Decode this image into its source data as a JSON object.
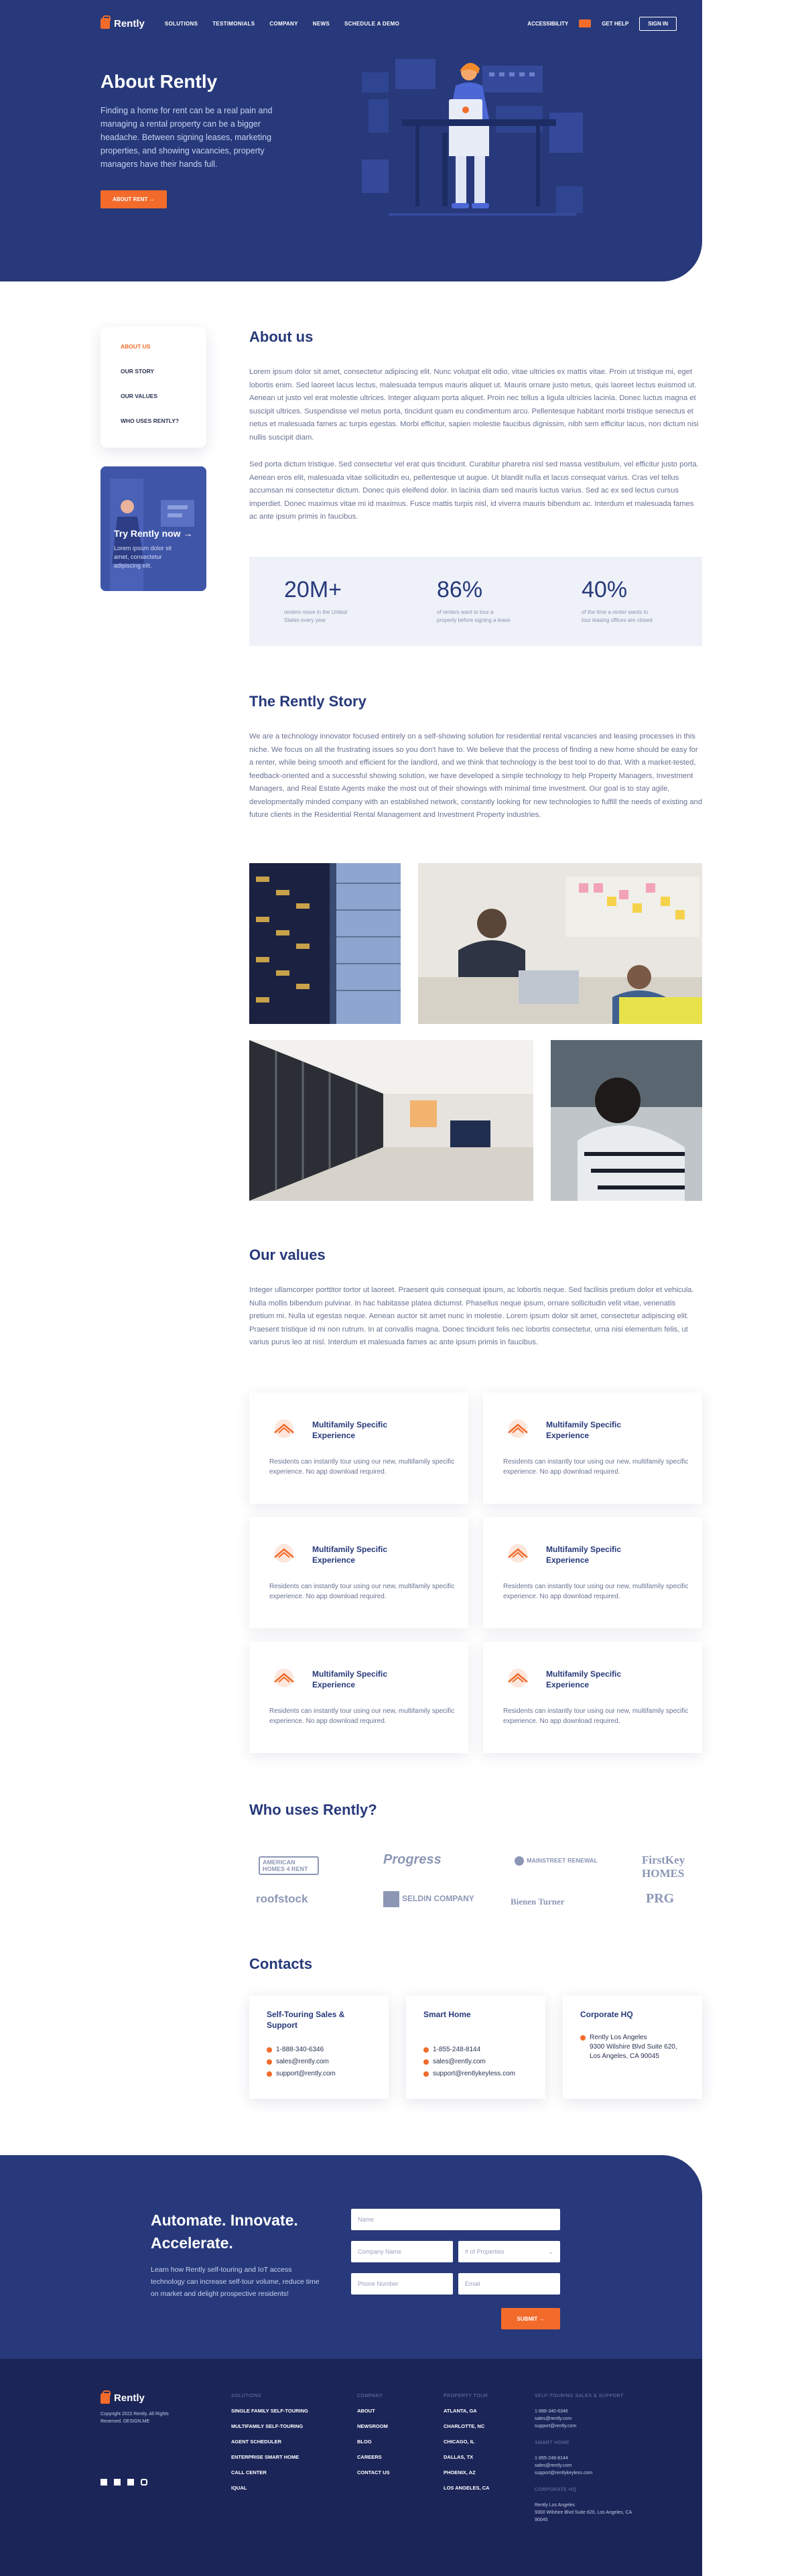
{
  "nav": {
    "brand": "Rently",
    "links": [
      "SOLUTIONS",
      "TESTIMONIALS",
      "COMPANY",
      "NEWS",
      "SCHEDULE A DEMO"
    ],
    "accessibility": "ACCESSIBILITY",
    "get_help": "GET HELP",
    "sign_in": "SIGN IN"
  },
  "hero": {
    "title": "About Rently",
    "text": "Finding a home for rent can be a real pain and managing a rental property can be a bigger headache. Between signing leases, marketing properties, and showing vacancies, property managers have their hands full.",
    "button": "ABOUT RENT"
  },
  "sidebar": {
    "items": [
      "ABOUT US",
      "OUR STORY",
      "OUR VALUES",
      "WHO USES RENTLY?"
    ],
    "try_title": "Try Rently now",
    "try_sub": "Lorem ipsum dolor sit amet, consectetur adipiscing elit."
  },
  "about": {
    "title": "About us",
    "p1": "Lorem ipsum dolor sit amet, consectetur adipiscing elit. Nunc volutpat elit odio, vitae ultricies ex mattis vitae. Proin ut tristique mi, eget lobortis enim. Sed laoreet lacus lectus, malesuada tempus mauris aliquet ut. Mauris ornare justo metus, quis laoreet lectus euismod ut. Aenean ut justo vel erat molestie ultrices. Integer aliquam porta aliquet. Proin nec tellus a ligula ultricies lacinia. Donec luctus magna et suscipit ultrices. Suspendisse vel metus porta, tincidunt quam eu condimentum arcu. Pellentesque habitant morbi tristique senectus et netus et malesuada fames ac turpis egestas. Morbi efficitur, sapien molestie faucibus dignissim, nibh sem efficitur lacus, non dictum nisi nullis suscipit diam.",
    "p2": "Sed porta dictum tristique. Sed consectetur vel erat quis tincidunt. Curabitur pharetra nisl sed massa vestibulum, vel efficitur justo porta. Aenean eros elit, malesuada vitae sollicitudin eu, pellentesque ut augue. Ut blandit nulla et lacus consequat varius. Cras vel tellus accumsan mi consectetur dictum. Donec quis eleifend dolor. In lacinia diam sed mauris luctus varius. Sed ac ex sed lectus cursus imperdiet. Donec maximus vitae mi id maximus. Fusce mattis turpis nisl, id viverra mauris bibendum ac. Interdum et malesuada fames ac ante ipsum primis in faucibus."
  },
  "stats": [
    {
      "value": "20M+",
      "desc": "renters move in the United States every year"
    },
    {
      "value": "86%",
      "desc": "of renters want to tour a property before signing a lease"
    },
    {
      "value": "40%",
      "desc": "of the time a renter wants to tour leasing offices are closed"
    }
  ],
  "story": {
    "title": "The Rently Story",
    "text": "We are a technology innovator focused entirely on a self-showing solution for residential rental vacancies and leasing processes in this niche. We focus on all the frustrating issues so you don't have to. We believe that the process of finding a new home should be easy for a renter, while being smooth and efficient for the landlord, and we think that technology is the best tool to do that. With a market-tested, feedback-oriented and a successful showing solution, we have developed a simple technology to help Property Managers, Investment Managers, and Real Estate Agents make the most out of their showings with minimal time investment. Our goal is to stay agile, developmentally minded company with an established network, constantly looking for new technologies to fulfill the needs of existing and future clients in the Residential Rental Management and Investment Property industries."
  },
  "values": {
    "title": "Our values",
    "text": "Integer ullamcorper porttitor tortor ut laoreet. Praesent quis consequat ipsum, ac lobortis neque. Sed facilisis pretium dolor et vehicula. Nulla mollis bibendum pulvinar. In hac habitasse platea dictumst. Phasellus neque ipsum, ornare sollicitudin velit vitae, venenatis pretium mi. Nulla ut egestas neque. Aenean auctor sit amet nunc in molestie. Lorem ipsum dolor sit amet, consectetur adipiscing elit. Praesent tristique id mi non rutrum. In at convallis magna. Donec tincidunt felis nec lobortis consectetur, urna nisi elementum felis, ut varius purus leo at nisl. Interdum et malesuada fames ac ante ipsum primis in faucibus.",
    "cards": [
      {
        "title": "Multifamily Specific Experience",
        "desc": "Residents can instantly tour using our new, multifamily specific experience. No app download required."
      },
      {
        "title": "Multifamily Specific Experience",
        "desc": "Residents can instantly tour using our new, multifamily specific experience. No app download required."
      },
      {
        "title": "Multifamily Specific Experience",
        "desc": "Residents can instantly tour using our new, multifamily specific experience. No app download required."
      },
      {
        "title": "Multifamily Specific Experience",
        "desc": "Residents can instantly tour using our new, multifamily specific experience. No app download required."
      },
      {
        "title": "Multifamily Specific Experience",
        "desc": "Residents can instantly tour using our new, multifamily specific experience. No app download required."
      },
      {
        "title": "Multifamily Specific Experience",
        "desc": "Residents can instantly tour using our new, multifamily specific experience. No app download required."
      }
    ]
  },
  "who": {
    "title": "Who uses Rently?",
    "logos": [
      "AMERICAN HOMES 4 RENT",
      "Progress",
      "MAINSTREET RENEWAL",
      "FirstKey HOMES",
      "roofstock",
      "SELDIN COMPANY",
      "Bienen Turner",
      "PRG"
    ]
  },
  "contacts": {
    "title": "Contacts",
    "cards": [
      {
        "title": "Self-Touring Sales & Support",
        "phone": "1-888-340-6346",
        "email1": "sales@rently.com",
        "email2": "support@rently.com"
      },
      {
        "title": "Smart Home",
        "phone": "1-855-248-8144",
        "email1": "sales@rently.com",
        "email2": "support@rentlykeyless.com"
      },
      {
        "title": "Corporate HQ",
        "address": "Rently Los Angeles\n9300 Wilshire Blvd Suite 620, Los Angeles, CA 90045"
      }
    ]
  },
  "cta": {
    "title": "Automate. Innovate. Accelerate.",
    "text": "Learn how Rently self-touring and IoT access technology can increase self-tour volume, reduce time on market and delight prospective residents!",
    "fields": {
      "name": "Name",
      "company": "Company Name",
      "properties": "# of Properties",
      "phone": "Phone Number",
      "email": "Email"
    },
    "submit": "SUBMIT"
  },
  "footer": {
    "brand": "Rently",
    "copyright": "Copyright 2022 Rently. All Rights Reserved. DESIGN.ME",
    "columns": [
      {
        "head": "SOLUTIONS",
        "items": [
          "SINGLE FAMILY SELF-TOURING",
          "MULTIFAMILY SELF-TOURING",
          "AGENT SCHEDULER",
          "ENTERPRISE SMART HOME",
          "CALL CENTER",
          "IQUAL"
        ]
      },
      {
        "head": "COMPANY",
        "items": [
          "ABOUT",
          "NEWSROOM",
          "BLOG",
          "CAREERS",
          "CONTACT US"
        ]
      },
      {
        "head": "PROPERTY TOUR",
        "items": [
          "ATLANTA, GA",
          "CHARLOTTE, NC",
          "CHICAGO, IL",
          "DALLAS, TX",
          "PHOENIX, AZ",
          "LOS ANGELES, CA"
        ]
      }
    ],
    "support": {
      "head": "SELF-TOURING SALES & SUPPORT",
      "lines": [
        "1-888-340-6346",
        "sales@rently.com",
        "support@rently.com"
      ],
      "smart_head": "SMART HOME",
      "smart_lines": [
        "1-855-248-8144",
        "sales@rently.com",
        "support@rentlykeyless.com"
      ],
      "hq_head": "CORPORATE HQ",
      "hq_lines": [
        "Rently Los Angeles",
        "9300 Wilshire Blvd Suite 620, Los Angeles, CA 90045"
      ]
    }
  },
  "colors": {
    "navy": "#27397a",
    "orange": "#f26b2b",
    "footer": "#1c2558"
  }
}
